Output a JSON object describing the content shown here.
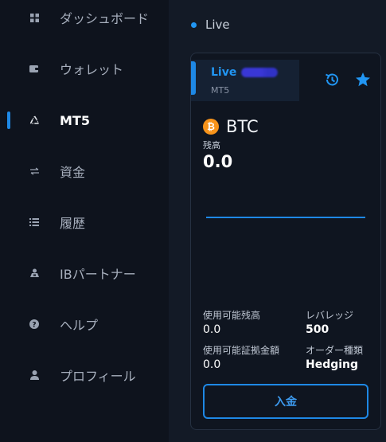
{
  "sidebar": {
    "items": [
      {
        "label": "ダッシュボード",
        "icon": "grid-icon"
      },
      {
        "label": "ウォレット",
        "icon": "wallet-icon"
      },
      {
        "label": "MT5",
        "icon": "recycle-icon",
        "active": true
      },
      {
        "label": "資金",
        "icon": "transfer-arrows-icon"
      },
      {
        "label": "履歴",
        "icon": "list-icon"
      },
      {
        "label": "IBパートナー",
        "icon": "partner-icon"
      },
      {
        "label": "ヘルプ",
        "icon": "help-icon"
      },
      {
        "label": "プロフィール",
        "icon": "user-icon"
      }
    ]
  },
  "main": {
    "section_title": "Live",
    "card": {
      "account_type": "Live",
      "platform": "MT5",
      "currency": "BTC",
      "balance_label": "残高",
      "balance_value": "0.0",
      "available_balance_label": "使用可能残高",
      "available_balance_value": "0.0",
      "leverage_label": "レバレッジ",
      "leverage_value": "500",
      "available_margin_label": "使用可能証拠金額",
      "available_margin_value": "0.0",
      "order_type_label": "オーダー種類",
      "order_type_value": "Hedging",
      "deposit_label": "入金"
    }
  },
  "colors": {
    "accent": "#1e88e5",
    "bitcoin": "#f7931a",
    "sidebar_bg": "#0e131d",
    "card_bg": "#0f1520"
  }
}
